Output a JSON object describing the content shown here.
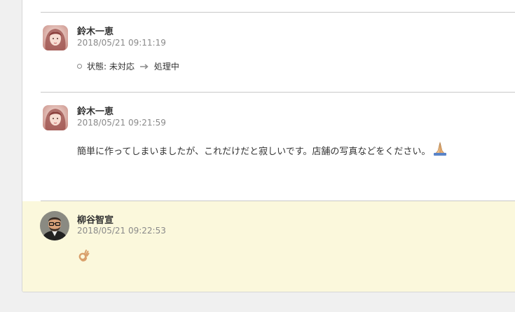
{
  "comments": [
    {
      "author": "鈴木一恵",
      "timestamp": "2018/05/21 09:11:19",
      "status_change": {
        "label": "状態: 未対応",
        "to": "処理中"
      }
    },
    {
      "author": "鈴木一恵",
      "timestamp": "2018/05/21 09:21:59",
      "text": "簡単に作ってしまいましたが、これだけだと寂しいです。店舗の写真などをください。",
      "emoji": "folded-hands-emoji"
    },
    {
      "author": "柳谷智宣",
      "timestamp": "2018/05/21 09:22:53",
      "emoji": "ok-hand-emoji"
    }
  ],
  "colors": {
    "highlight_background": "#fbf8dc",
    "divider": "#c9c9c9",
    "timestamp": "#8a8a8a"
  }
}
